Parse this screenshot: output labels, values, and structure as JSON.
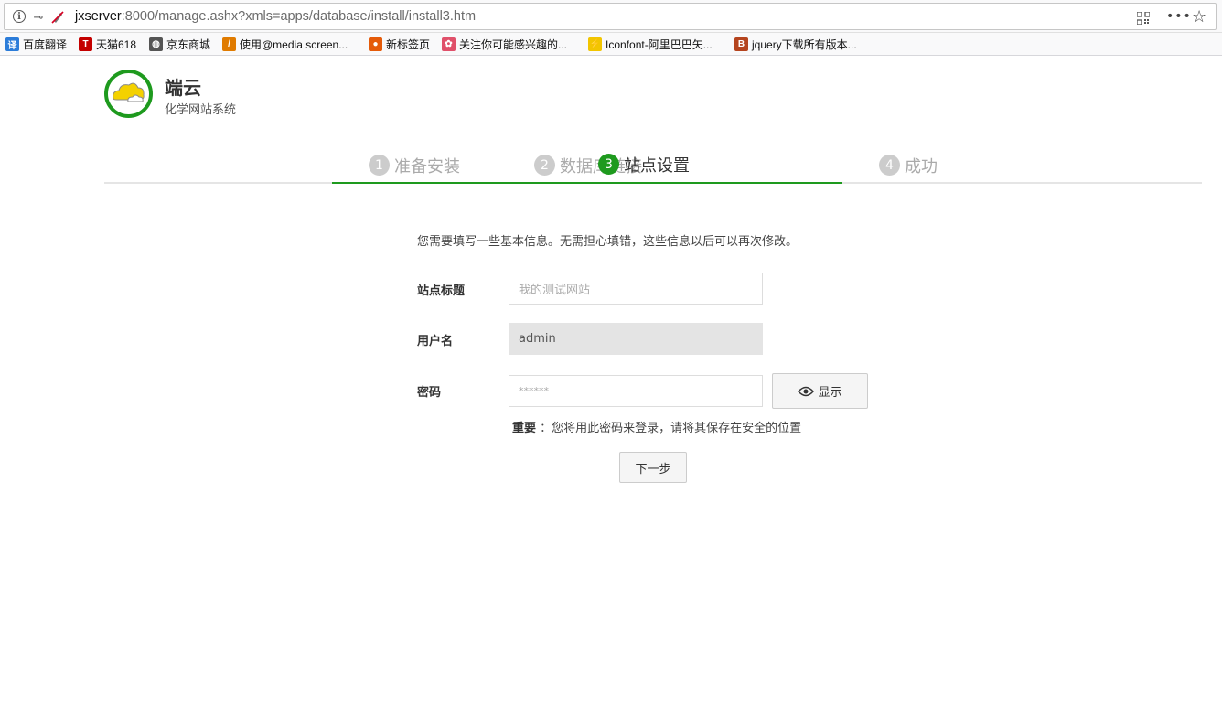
{
  "browser": {
    "url_host": "jxserver",
    "url_rest": ":8000/manage.ashx?xmls=apps/database/install/install3.htm",
    "bookmarks": [
      {
        "label": "百度翻译",
        "icon": "translate-icon",
        "color": "#2b7cd9",
        "glyph": "译"
      },
      {
        "label": "天猫618",
        "icon": "tmall-icon",
        "color": "#c40000",
        "glyph": "T"
      },
      {
        "label": "京东商城",
        "icon": "globe-icon",
        "color": "#555555",
        "glyph": "◍"
      },
      {
        "label": "使用@media screen...",
        "icon": "slash-logo-icon",
        "color": "#e07b00",
        "glyph": "/"
      },
      {
        "label": "新标签页",
        "icon": "firefox-icon",
        "color": "#e55b0a",
        "glyph": "●"
      },
      {
        "label": "关注你可能感兴趣的...",
        "icon": "flower-icon",
        "color": "#e0506a",
        "glyph": "✿"
      },
      {
        "label": "Iconfont-阿里巴巴矢...",
        "icon": "iconfont-icon",
        "color": "#f2c500",
        "glyph": "⚡"
      },
      {
        "label": "jquery下载所有版本...",
        "icon": "b-logo-icon",
        "color": "#b5441e",
        "glyph": "B"
      }
    ]
  },
  "brand": {
    "name": "端云",
    "subtitle": "化学网站系统",
    "accent": "#1e9a1e"
  },
  "steps": [
    {
      "num": "1",
      "label": "准备安装",
      "active": false
    },
    {
      "num": "2",
      "label": "数据库链接",
      "active": false
    },
    {
      "num": "3",
      "label": "站点设置",
      "active": true
    },
    {
      "num": "4",
      "label": "成功",
      "active": false
    }
  ],
  "form": {
    "intro": "您需要填写一些基本信息。无需担心填错，这些信息以后可以再次修改。",
    "site_title_label": "站点标题",
    "site_title_placeholder": "我的测试网站",
    "username_label": "用户名",
    "username_value": "admin",
    "password_label": "密码",
    "password_placeholder": "******",
    "show_label": "显示",
    "hint_strong": "重要",
    "hint_text": "：您将用此密码来登录，请将其保存在安全的位置",
    "next_label": "下一步"
  }
}
